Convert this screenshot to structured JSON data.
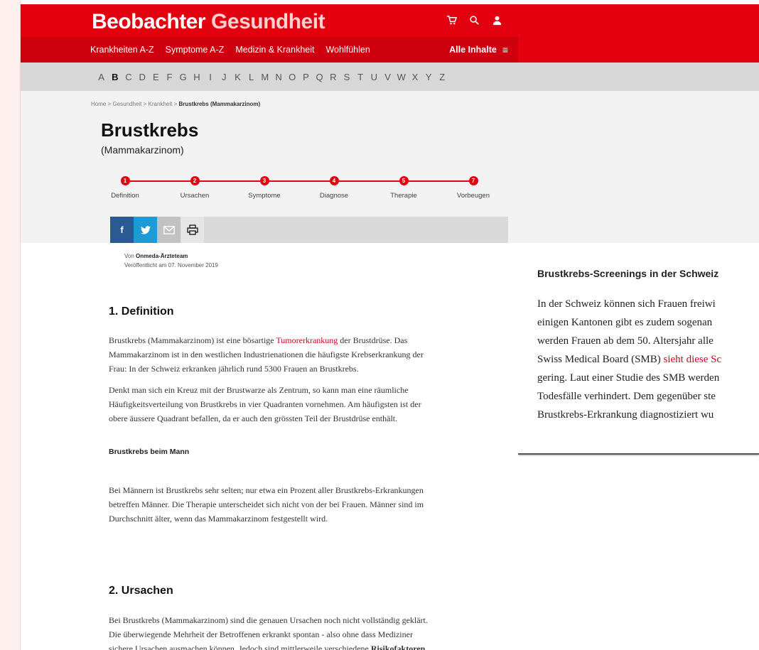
{
  "brand": {
    "word1": "Beobachter",
    "word2": "Gesundheit"
  },
  "top_icons": [
    "cart-icon",
    "search-icon",
    "user-icon"
  ],
  "nav": {
    "items": [
      "Krankheiten A-Z",
      "Symptome A-Z",
      "Medizin & Krankheit",
      "Wohlfühlen"
    ],
    "all_label": "Alle Inhalte",
    "menu_glyph": "≡"
  },
  "alphabet": {
    "letters": [
      "A",
      "B",
      "C",
      "D",
      "E",
      "F",
      "G",
      "H",
      "I",
      "J",
      "K",
      "L",
      "M",
      "N",
      "O",
      "P",
      "Q",
      "R",
      "S",
      "T",
      "U",
      "V",
      "W",
      "X",
      "Y",
      "Z"
    ],
    "active": "B"
  },
  "breadcrumb": {
    "items": [
      "Home",
      "Gesundheit",
      "Krankheit"
    ],
    "current": "Brustkrebs (Mammakarzinom)",
    "separator": ">"
  },
  "article": {
    "title": "Brustkrebs",
    "subtitle": "(Mammakarzinom)",
    "author_prefix": "Von",
    "author": "Onmeda-Ärzteteam",
    "published": "Veröffentlicht am 07. November 2019"
  },
  "steps": [
    {
      "num": "1",
      "label": "Definition"
    },
    {
      "num": "2",
      "label": "Ursachen"
    },
    {
      "num": "3",
      "label": "Symptome"
    },
    {
      "num": "4",
      "label": "Diagnose"
    },
    {
      "num": "5",
      "label": "Therapie"
    },
    {
      "num": "7",
      "label": "Vorbeugen"
    }
  ],
  "share": {
    "facebook": "f",
    "twitter": "✓",
    "mail": "✉",
    "print": "⎙"
  },
  "sections": {
    "definition": {
      "heading": "1. Definition",
      "p1_before": "Brustkrebs (Mammakarzinom) ist eine bösartige ",
      "p1_link": "Tumorerkrankung",
      "p1_l1_after": " der Brustdrüse. Das",
      "p1_l2": "Mammakarzinom ist in den westlichen Industrienationen die häufigste Krebserkrankung der",
      "p1_l3": "Frau: In der Schweiz erkranken jährlich rund 5300 Frauen an Brustkrebs.",
      "p2_l1": "Denkt man sich ein Kreuz mit der Brustwarze als Zentrum, so kann man eine räumliche",
      "p2_l2": "Häufigkeitsverteilung von Brustkrebs in vier Quadranten vornehmen. Am häufigsten ist der",
      "p2_l3": "obere äussere Quadrant befallen, da er auch den grössten Teil der Brustdrüse enthält.",
      "sub_heading": "Brustkrebs beim Mann",
      "p3_l1": "Bei Männern ist Brustkrebs sehr selten; nur etwa ein Prozent aller Brustkrebs-Erkrankungen",
      "p3_l2": "betreffen Männer. Die Therapie unterscheidet sich nicht von der bei Frauen. Männer sind im",
      "p3_l3": "Durchschnitt älter, wenn das Mammakarzinom festgestellt wird."
    },
    "ursachen": {
      "heading": "2. Ursachen",
      "p1_l1": "Bei Brustkrebs (Mammakarzinom) sind die genauen Ursachen noch nicht vollständig geklärt.",
      "p1_l2": "Die überwiegende Mehrheit der Betroffenen erkrankt spontan - also ohne dass Mediziner",
      "p1_l3_before": "sichere Ursachen ausmachen können. Jedoch sind mittlerweile verschiedene ",
      "p1_l3_bold": "Risikofaktoren"
    }
  },
  "sidebox": {
    "heading": "Brustkrebs-Screenings in der Schweiz",
    "l1": "In der Schweiz können sich Frauen freiwi",
    "l2": "einigen Kantonen gibt es zudem sogenan",
    "l3": "werden Frauen ab dem 50. Altersjahr alle",
    "l4_before": "Swiss Medical Board (SMB) ",
    "l4_link": "sieht diese Sc",
    "l5": "gering. Laut einer Studie des SMB werden",
    "l6": "Todesfälle verhindert. Dem gegenüber ste",
    "l7": "Brustkrebs-Erkrankung diagnostiziert wu"
  },
  "colors": {
    "brand_red": "#e3000f",
    "nav_red": "#cf000d",
    "link_red": "#d0021b",
    "facebook": "#2a5a94",
    "twitter": "#1d9bd6"
  }
}
